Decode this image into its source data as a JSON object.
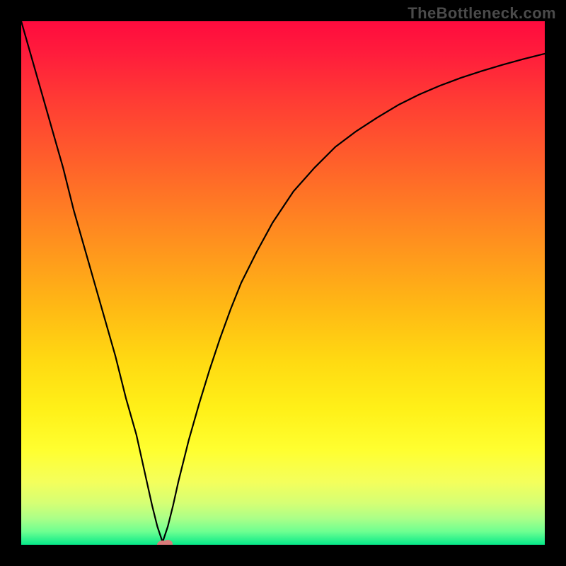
{
  "watermark": "TheBottleneck.com",
  "chart_data": {
    "type": "line",
    "title": "",
    "xlabel": "",
    "ylabel": "",
    "xlim": [
      0,
      100
    ],
    "ylim": [
      0,
      100
    ],
    "grid": false,
    "legend": null,
    "annotations": [],
    "marker": {
      "x": 27,
      "y": 0
    },
    "series": [
      {
        "name": "curve",
        "x": [
          0,
          2,
          4,
          6,
          8,
          10,
          12,
          14,
          16,
          18,
          20,
          22,
          24,
          25,
          26,
          27,
          28,
          29,
          30,
          32,
          34,
          36,
          38,
          40,
          42,
          45,
          48,
          52,
          56,
          60,
          64,
          68,
          72,
          76,
          80,
          84,
          88,
          92,
          96,
          100
        ],
        "values": [
          100,
          93,
          86,
          79,
          72,
          64,
          57,
          50,
          43,
          36,
          28,
          21,
          12,
          7.5,
          3.5,
          0.5,
          3.5,
          7.5,
          12,
          20,
          27,
          33.5,
          39.5,
          45,
          50,
          56,
          61.5,
          67.5,
          72,
          76,
          79,
          81.6,
          84,
          86,
          87.7,
          89.2,
          90.5,
          91.7,
          92.8,
          93.8
        ]
      }
    ],
    "gradient_stops": [
      {
        "pos": 0.0,
        "color": "#ff0b3e"
      },
      {
        "pos": 0.06,
        "color": "#ff1c3c"
      },
      {
        "pos": 0.15,
        "color": "#ff3b34"
      },
      {
        "pos": 0.25,
        "color": "#ff5a2c"
      },
      {
        "pos": 0.35,
        "color": "#ff7a24"
      },
      {
        "pos": 0.45,
        "color": "#ff9a1c"
      },
      {
        "pos": 0.55,
        "color": "#ffba14"
      },
      {
        "pos": 0.65,
        "color": "#ffda12"
      },
      {
        "pos": 0.74,
        "color": "#fff018"
      },
      {
        "pos": 0.82,
        "color": "#ffff30"
      },
      {
        "pos": 0.88,
        "color": "#f4ff5c"
      },
      {
        "pos": 0.92,
        "color": "#d6ff74"
      },
      {
        "pos": 0.95,
        "color": "#aaff88"
      },
      {
        "pos": 0.975,
        "color": "#6dff91"
      },
      {
        "pos": 1.0,
        "color": "#06e989"
      }
    ]
  }
}
